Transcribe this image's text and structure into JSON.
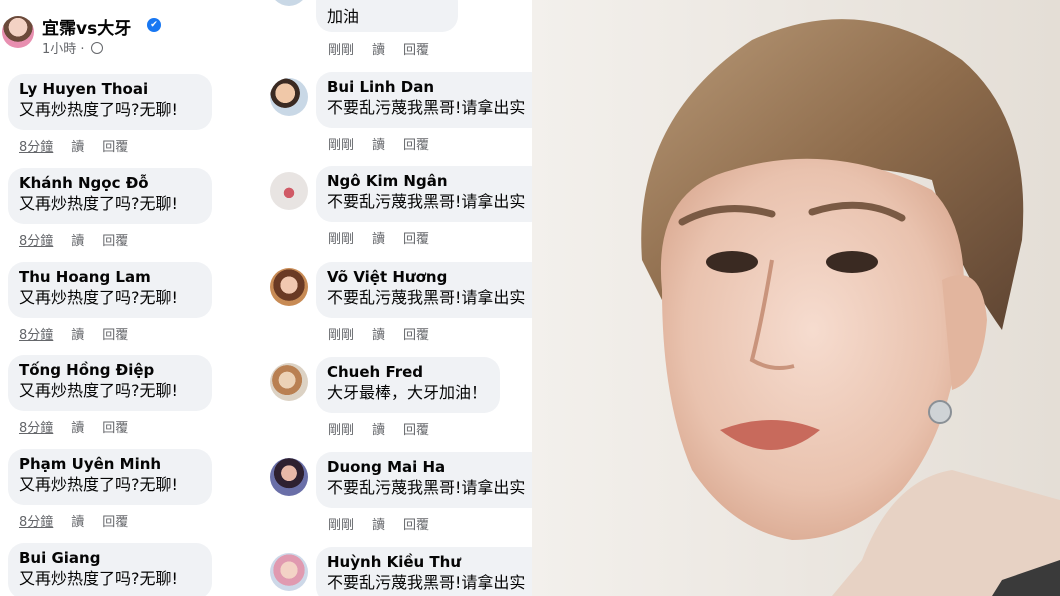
{
  "post": {
    "page_name": "宜霈vs大牙",
    "verified_badge": "✔",
    "time": "1小時 ·",
    "globe_icon": "globe-icon"
  },
  "labels": {
    "read": "讀",
    "reply": "回覆",
    "just_now": "剛剛"
  },
  "left_comments": [
    {
      "author": "Ly Huyen Thoai",
      "text": "又再炒热度了吗?无聊!",
      "time": "8分鐘"
    },
    {
      "author": "Khánh Ngọc Đỗ",
      "text": "又再炒热度了吗?无聊!",
      "time": "8分鐘"
    },
    {
      "author": "Thu Hoang Lam",
      "text": "又再炒热度了吗?无聊!",
      "time": "8分鐘"
    },
    {
      "author": "Tống Hồng Điệp",
      "text": "又再炒热度了吗?无聊!",
      "time": "8分鐘"
    },
    {
      "author": "Phạm Uyên Minh",
      "text": "又再炒热度了吗?无聊!",
      "time": "8分鐘"
    },
    {
      "author": "Bui Giang",
      "text": "又再炒热度了吗?无聊!"
    }
  ],
  "top_partial_comment": {
    "text": "加油",
    "time": "剛剛"
  },
  "mid_comments": [
    {
      "author": "Bui Linh Dan",
      "text": "不要乱污蔑我黑哥!请拿出实",
      "time": "剛剛"
    },
    {
      "author": "Ngô Kim Ngân",
      "text": "不要乱污蔑我黑哥!请拿出实",
      "time": "剛剛"
    },
    {
      "author": "Võ Việt Hương",
      "text": "不要乱污蔑我黑哥!请拿出实",
      "time": "剛剛"
    },
    {
      "author": "Chueh Fred",
      "text": "大牙最棒，大牙加油！",
      "time": "剛剛"
    },
    {
      "author": "Duong Mai Ha",
      "text": "不要乱污蔑我黑哥!请拿出实",
      "time": "剛剛"
    },
    {
      "author": "Huỳnh Kiều Thư",
      "text": "不要乱污蔑我黑哥!请拿出实"
    }
  ]
}
